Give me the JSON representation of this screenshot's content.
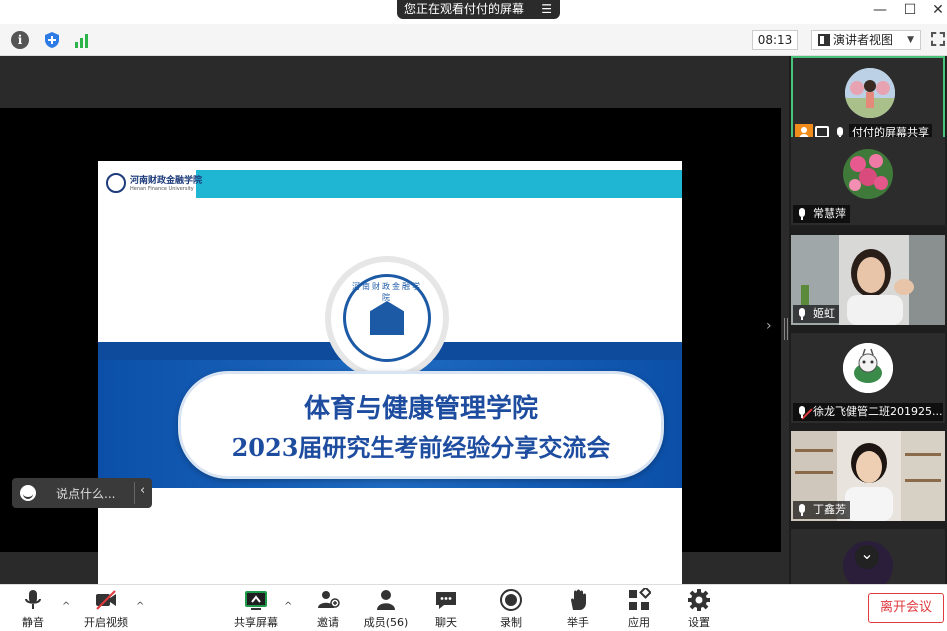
{
  "titlebar": {
    "share_notice": "您正在观看付付的屏幕",
    "menu_glyph": "☰"
  },
  "window_controls": {
    "minimize": "—",
    "maximize": "☐",
    "close": "✕"
  },
  "toolbar": {
    "info_glyph": "i",
    "meeting_time": "08:13",
    "view_mode": "演讲者视图",
    "view_caret": "▼"
  },
  "slide": {
    "school_name": "河南财政金融学院",
    "school_name_en": "Henan Finance University",
    "emblem_text": "河南财政金融学院",
    "title_line1": "体育与健康管理学院",
    "title_line2": "2023届研究生考前经验分享交流会"
  },
  "chat": {
    "placeholder": "说点什么...",
    "collapse_glyph": "‹"
  },
  "panel_arrow": "›",
  "participants": [
    {
      "name": "付付的屏幕共享",
      "active": true
    },
    {
      "name": "常慧萍",
      "muted": false
    },
    {
      "name": "姬虹",
      "muted": false
    },
    {
      "name": "徐龙飞健管二班201925...",
      "muted": true
    },
    {
      "name": "丁鑫芳",
      "muted": false
    },
    {
      "name": "",
      "scroll_glyph": "⌄"
    }
  ],
  "controls": {
    "mute": "静音",
    "video": "开启视频",
    "share": "共享屏幕",
    "invite": "邀请",
    "members": "成员(56)",
    "chat": "聊天",
    "record": "录制",
    "raise_hand": "举手",
    "apps": "应用",
    "settings": "设置",
    "leave": "离开会议",
    "caret": "^"
  },
  "colors": {
    "leave_red": "#e0393e",
    "active_green": "#4ac27a",
    "slide_blue": "#1e4da0",
    "slide_cyan": "#1fb6d4"
  }
}
